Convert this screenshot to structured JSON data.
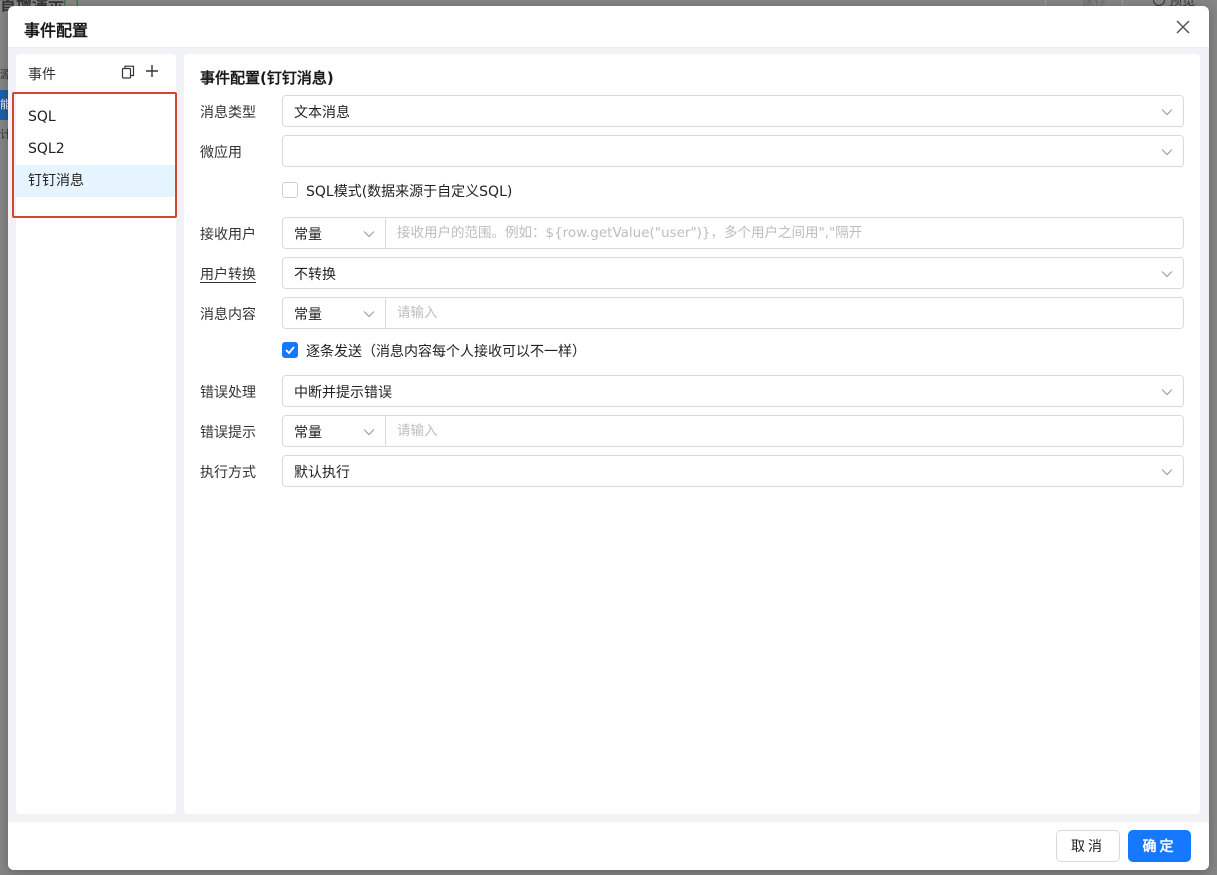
{
  "background": {
    "title": "首增演示",
    "save_label": "保存",
    "preview_label": "预览",
    "side_items": [
      "源",
      "能",
      "计"
    ]
  },
  "dialog": {
    "title": "事件配置",
    "close_icon": "close-icon"
  },
  "events": {
    "header": "事件",
    "copy_icon": "copy-icon",
    "add_icon": "plus-icon",
    "items": [
      {
        "label": "SQL",
        "active": false
      },
      {
        "label": "SQL2",
        "active": false
      },
      {
        "label": "钉钉消息",
        "active": true
      }
    ],
    "highlight_color": "#d0462f"
  },
  "config": {
    "title": "事件配置(钉钉消息)",
    "message_type": {
      "label": "消息类型",
      "value": "文本消息"
    },
    "micro_app": {
      "label": "微应用",
      "value": ""
    },
    "sql_mode": {
      "label": "SQL模式(数据来源于自定义SQL)",
      "checked": false
    },
    "receiver": {
      "label": "接收用户",
      "mode": "常量",
      "placeholder": "接收用户的范围。例如：${row.getValue(\"user\")}，多个用户之间用\",\"隔开"
    },
    "user_convert": {
      "label": "用户转换",
      "value": "不转换"
    },
    "content": {
      "label": "消息内容",
      "mode": "常量",
      "placeholder": "请输入"
    },
    "send_each": {
      "label": "逐条发送（消息内容每个人接收可以不一样）",
      "checked": true
    },
    "error_handling": {
      "label": "错误处理",
      "value": "中断并提示错误"
    },
    "error_tip": {
      "label": "错误提示",
      "mode": "常量",
      "placeholder": "请输入"
    },
    "exec_mode": {
      "label": "执行方式",
      "value": "默认执行"
    }
  },
  "footer": {
    "cancel_label": "取消",
    "ok_label": "确定"
  },
  "colors": {
    "primary": "#1677ff",
    "selected_bg": "#e6f4ff",
    "border": "#d9d9d9"
  }
}
